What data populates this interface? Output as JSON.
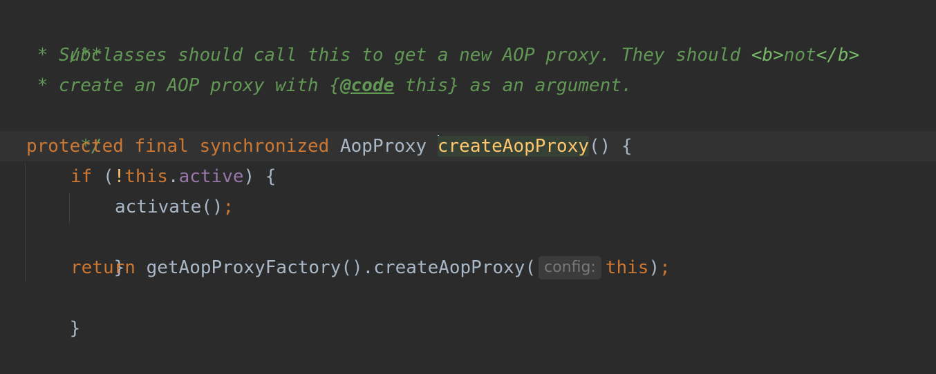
{
  "editor": {
    "doc_open": "/**",
    "doc_line1_prefix": " * Subclasses should call this to get a new AOP proxy. They should ",
    "doc_line1_tag_open": "<b>",
    "doc_line1_not": "not",
    "doc_line1_tag_close": "</b>",
    "doc_line2_prefix": " * create an AOP proxy with {",
    "doc_line2_tag": "@code",
    "doc_line2_suffix": " this} as an argument.",
    "doc_close": " */",
    "sig_protected": "protected",
    "sig_final": "final",
    "sig_synchronized": "synchronized",
    "sig_return_type": "AopProxy",
    "sig_method_name": "createAopProxy",
    "sig_parens": "()",
    "sig_brace": "{",
    "if_kw": "if",
    "if_open_paren": "(",
    "if_bang": "!",
    "if_this": "this",
    "if_dot": ".",
    "if_field": "active",
    "if_close": ") {",
    "activate_call": "activate()",
    "semicolon": ";",
    "if_end_brace": "}",
    "return_kw": "return",
    "return_call": "getAopProxyFactory().createAopProxy(",
    "param_hint": "config:",
    "return_this": "this",
    "return_close_paren": ")",
    "method_end_brace": "}"
  },
  "colors": {
    "background": "#2b2b2b",
    "current_line": "#323232",
    "keyword": "#cc7832",
    "doc_comment": "#629755",
    "method_declaration": "#ffc66d",
    "field": "#9876aa",
    "default_text": "#a9b7c6",
    "hint_text": "#787878"
  }
}
